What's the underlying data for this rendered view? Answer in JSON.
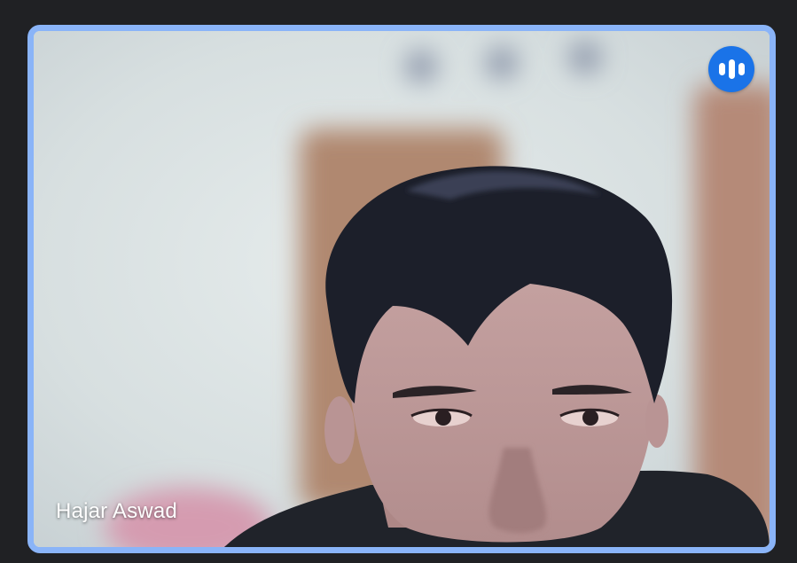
{
  "participant": {
    "name": "Hajar Aswad",
    "is_speaking": true,
    "speaking_icon": "audio-level-bars-icon"
  },
  "colors": {
    "page_background": "#202124",
    "active_speaker_border": "#8ab4f8",
    "speaking_badge": "#1a73e8",
    "name_text": "#ffffff"
  }
}
